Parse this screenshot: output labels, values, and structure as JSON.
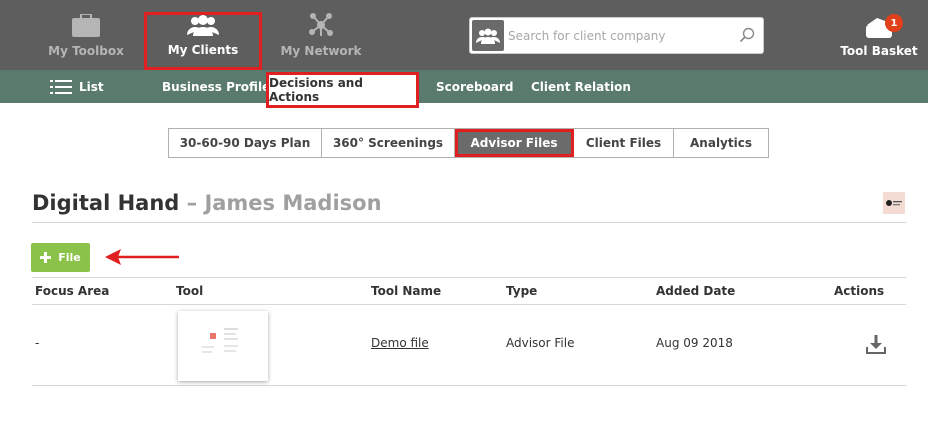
{
  "topnav": {
    "toolbox_label": "My Toolbox",
    "clients_label": "My Clients",
    "network_label": "My Network",
    "search_placeholder": "Search for client company",
    "basket_label": "Tool Basket",
    "basket_count": "1"
  },
  "subnav": {
    "list_label": "List",
    "items": [
      "Business Profile",
      "Decisions and Actions",
      "Scoreboard",
      "Client Relation"
    ]
  },
  "tabs": [
    "30-60-90 Days Plan",
    "360° Screenings",
    "Advisor Files",
    "Client Files",
    "Analytics"
  ],
  "page": {
    "company": "Digital Hand",
    "dash": " – ",
    "client": "James Madison"
  },
  "file_button_label": "File",
  "table": {
    "headers": [
      "Focus Area",
      "Tool",
      "Tool Name",
      "Type",
      "Added Date",
      "Actions"
    ],
    "rows": [
      {
        "focus_area": "-",
        "tool_name": "Demo file",
        "type": "Advisor File",
        "added_date": "Aug 09 2018"
      }
    ]
  },
  "colors": {
    "topbar": "#5e5e5e",
    "subbar": "#5b7a6e",
    "highlight": "#e02020",
    "file_button": "#8bc34a",
    "badge": "#e0401a"
  }
}
